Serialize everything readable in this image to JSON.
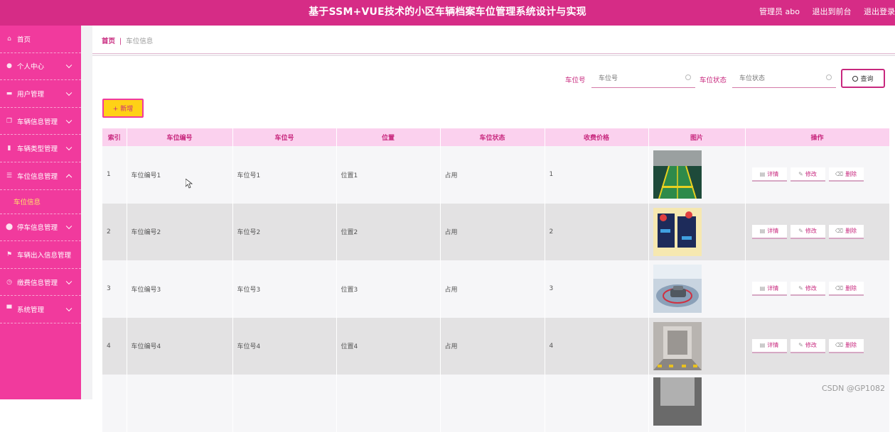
{
  "header": {
    "title": "基于SSM+VUE技术的小区车辆档案车位管理系统设计与实现",
    "user": "管理员 abo",
    "back_to_front": "退出到前台",
    "logout": "退出登录"
  },
  "sidebar": {
    "items": [
      {
        "label": "首页",
        "icon": "home-icon"
      },
      {
        "label": "个人中心",
        "icon": "user-icon"
      },
      {
        "label": "用户管理",
        "icon": "users-icon"
      },
      {
        "label": "车辆信息管理",
        "icon": "copy-icon"
      },
      {
        "label": "车辆类型管理",
        "icon": "bar-chart-icon"
      },
      {
        "label": "车位信息管理",
        "icon": "list-icon"
      },
      {
        "label": "车位信息",
        "icon": ""
      },
      {
        "label": "停车信息管理",
        "icon": "location-icon"
      },
      {
        "label": "车辆出入信息管理",
        "icon": "flag-icon"
      },
      {
        "label": "缴费信息管理",
        "icon": "clock-icon"
      },
      {
        "label": "系统管理",
        "icon": "monitor-icon"
      }
    ]
  },
  "breadcrumb": {
    "home": "首页",
    "separator": "|",
    "current": "车位信息"
  },
  "search": {
    "label1": "车位号",
    "placeholder1": "车位号",
    "label2": "车位状态",
    "placeholder2": "车位状态",
    "button": "查询"
  },
  "add_button": "+ 新增",
  "table": {
    "headers": [
      "索引",
      "车位编号",
      "车位号",
      "位置",
      "车位状态",
      "收费价格",
      "图片",
      "操作"
    ],
    "rows": [
      {
        "index": "1",
        "code": "车位编号1",
        "number": "车位号1",
        "position": "位置1",
        "status": "占用",
        "price": "1"
      },
      {
        "index": "2",
        "code": "车位编号2",
        "number": "车位号2",
        "position": "位置2",
        "status": "占用",
        "price": "2"
      },
      {
        "index": "3",
        "code": "车位编号3",
        "number": "车位号3",
        "position": "位置3",
        "status": "占用",
        "price": "3"
      },
      {
        "index": "4",
        "code": "车位编号4",
        "number": "车位号4",
        "position": "位置4",
        "status": "占用",
        "price": "4"
      },
      {
        "index": "",
        "code": "",
        "number": "",
        "position": "",
        "status": "",
        "price": ""
      }
    ],
    "ops": {
      "detail": "详情",
      "edit": "修改",
      "delete": "删除"
    }
  },
  "watermark": "CSDN @GP1082",
  "colors": {
    "header": "#d62c86",
    "sidebar": "#f13a9d",
    "accent": "#c8287e",
    "active_sub": "#ffe06b",
    "add_button": "#ffd116",
    "table_header": "#fbd1ee"
  }
}
